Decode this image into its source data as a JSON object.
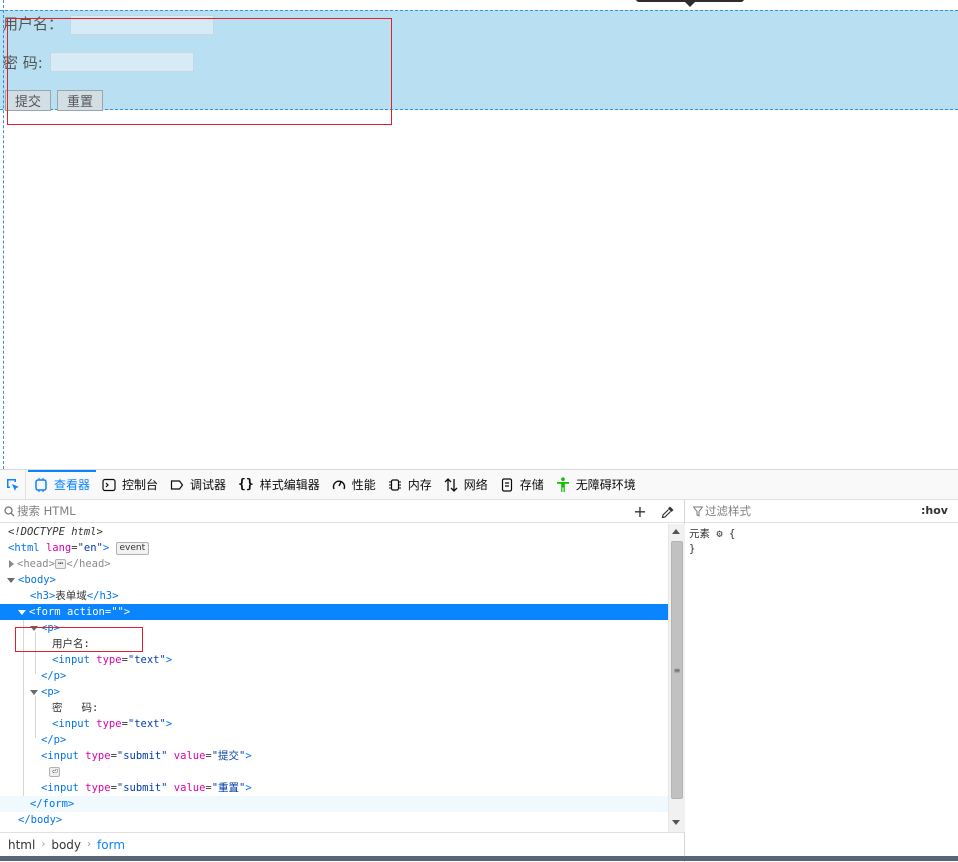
{
  "page_preview": {
    "username_label": "用户名：",
    "password_label": "密  码:",
    "submit_label": "提交",
    "reset_label": "重置"
  },
  "devtools": {
    "tabs": [
      {
        "label": "查看器",
        "icon": "inspector-icon"
      },
      {
        "label": "控制台",
        "icon": "console-icon"
      },
      {
        "label": "调试器",
        "icon": "debugger-icon"
      },
      {
        "label": "样式编辑器",
        "icon": "braces-icon"
      },
      {
        "label": "性能",
        "icon": "gauge-icon"
      },
      {
        "label": "内存",
        "icon": "memory-chip-icon"
      },
      {
        "label": "网络",
        "icon": "network-arrows-icon"
      },
      {
        "label": "存储",
        "icon": "storage-icon"
      },
      {
        "label": "无障碍环境",
        "icon": "accessibility-icon"
      }
    ],
    "search_placeholder": "搜索 HTML",
    "add_symbol": "+",
    "filter_placeholder": "过滤样式",
    "hov_label": ":hov",
    "rule_selector": "元素",
    "rule_open": "{",
    "rule_close": "}",
    "tree": {
      "doctype": "<!DOCTYPE html>",
      "html_open_tag": "<html",
      "html_lang_attr": "lang",
      "html_lang_value": "\"en\"",
      "html_close_bracket": ">",
      "event_badge": "event",
      "head_open": "<head>",
      "head_ellipsis": "⋯",
      "head_close": "</head>",
      "body_open": "<body>",
      "h3_open": "<h3>",
      "h3_text": "表单域",
      "h3_close": "</h3>",
      "form_open": "<form",
      "form_attr": "action",
      "form_value": "\"\"",
      "form_close_bracket": ">",
      "p_open": "<p>",
      "username_text": "用户名:",
      "input_open": "<input",
      "type_attr": "type",
      "type_text_value": "\"text\"",
      "p_close": "</p>",
      "password_text": "密   码:",
      "type_submit_value": "\"submit\"",
      "value_attr": "value",
      "submit_value": "\"提交\"",
      "reset_value": "\"重置\"",
      "whitespace_badge": "⏎",
      "form_close": "</form>",
      "body_close": "</body>"
    },
    "breadcrumbs": [
      "html",
      "body",
      "form"
    ]
  }
}
